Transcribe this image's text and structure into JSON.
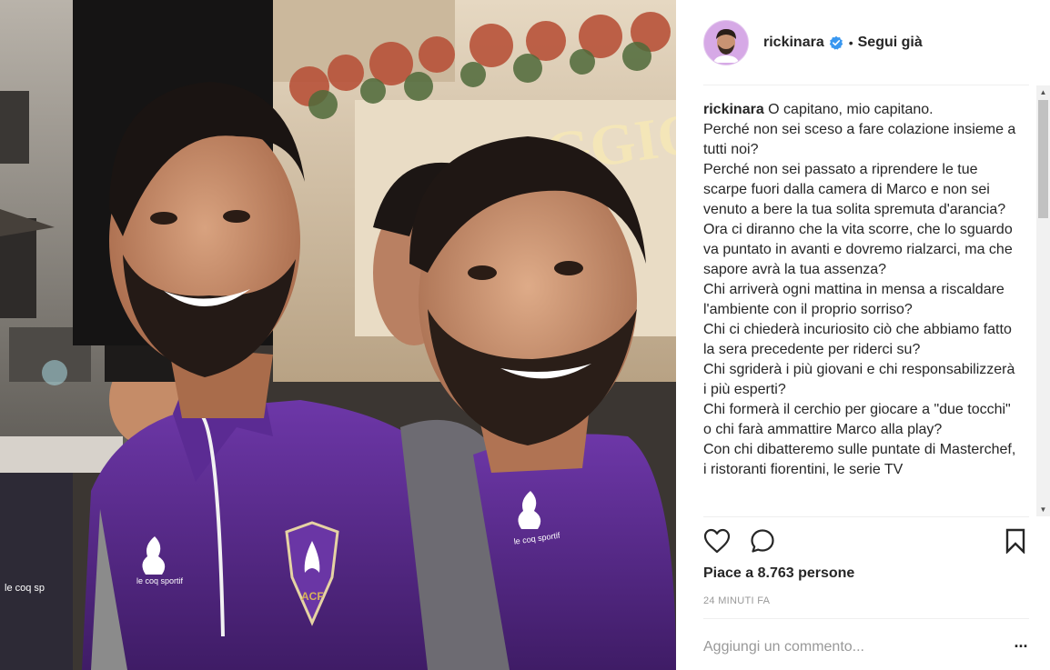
{
  "post": {
    "username": "rickinara",
    "verified_icon": "verified-badge-icon",
    "follow_dot": "•",
    "follow_label": "Segui già",
    "caption_username": "rickinara",
    "caption_text": " O capitano, mio capitano.\nPerché non sei sceso a fare colazione insieme a tutti noi?\nPerché non sei passato a riprendere le tue scarpe fuori dalla camera di Marco e non sei venuto a bere la tua solita spremuta d'arancia?\nOra ci diranno che la vita scorre, che lo sguardo va puntato in avanti e dovremo rialzarci, ma che sapore avrà la tua assenza?\nChi arriverà ogni mattina in mensa a riscaldare l'ambiente con il proprio sorriso?\nChi ci chiederà incuriosito ciò che abbiamo fatto la sera precedente per riderci su?\nChi sgriderà i più giovani e chi responsabilizzerà i più esperti?\nChi formerà il cerchio per giocare a \"due tocchi\" o chi farà ammattire Marco alla play?\nCon chi dibatteremo sulle puntate di Masterchef, i ristoranti fiorentini, le serie TV",
    "likes": "Piace a 8.763 persone",
    "timestamp": "24 MINUTI FA",
    "comment_placeholder": "Aggiungi un commento...",
    "more_label": "..."
  },
  "photo": {
    "sign_text": "GGIO",
    "left_kit_brand": "le coq sportif",
    "crest_text": "ACF",
    "right_kit_brand": "le coq sportif"
  },
  "colors": {
    "jersey_purple": "#5a2b8c",
    "link_blue": "#3897f0",
    "text": "#262626",
    "muted": "#999999"
  }
}
